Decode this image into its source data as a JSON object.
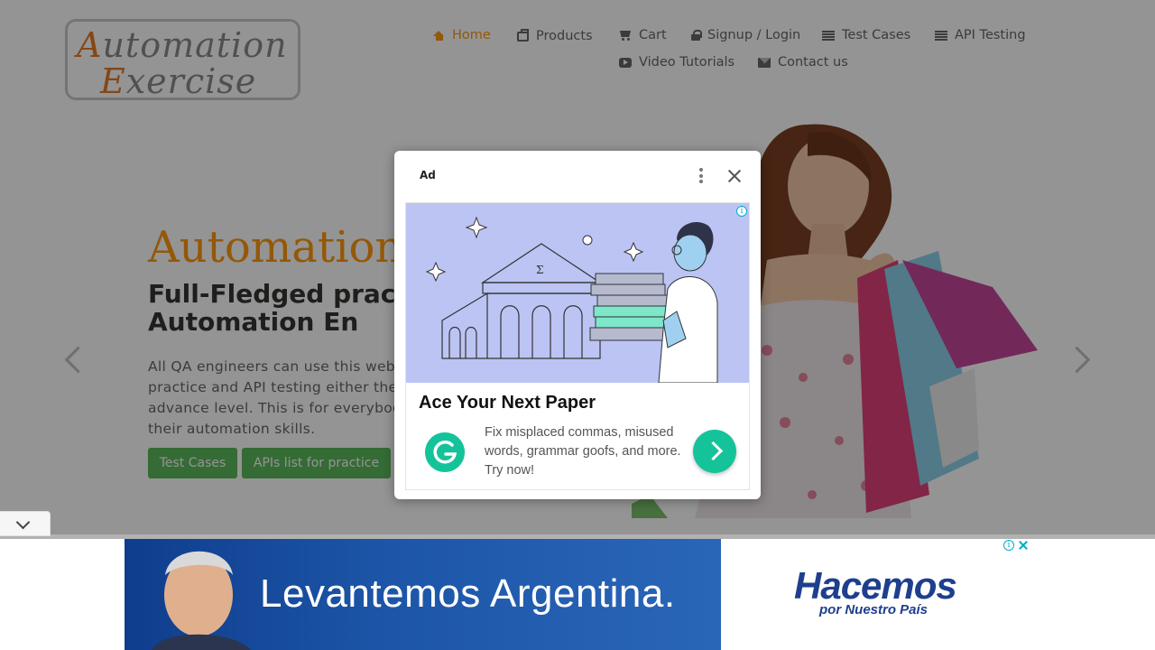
{
  "header": {
    "logo_line1_cap": "A",
    "logo_line1_rest": "utomation",
    "logo_line2_cap": "E",
    "logo_line2_rest": "xercise",
    "nav": {
      "home": "Home",
      "products": "Products",
      "cart": "Cart",
      "login": "Signup / Login",
      "test_cases": "Test Cases",
      "api_testing": "API Testing",
      "video_tutorials": "Video Tutorials",
      "contact_us": "Contact us"
    },
    "icons": [
      "home-icon",
      "briefcase-icon",
      "cart-icon",
      "lock-icon",
      "list-icon",
      "list-icon",
      "youtube-icon",
      "envelope-icon"
    ]
  },
  "hero": {
    "title": "Automation",
    "subtitle": "Full-Fledged prac for Automation En",
    "text": "All QA engineers can use this web practice and API testing either the advance level. This is for everybod their automation skills.",
    "btn_test_cases": "Test Cases",
    "btn_apis": "APIs list for practice"
  },
  "ad_modal": {
    "label": "Ad",
    "headline": "Ace Your Next Paper",
    "body": "Fix misplaced commas, misused words, grammar goofs, and more. Try now!",
    "info": "i"
  },
  "bottom_ad": {
    "tagline": "Levantemos Argentina.",
    "brand": "Hacemos",
    "brand_sub": "por Nuestro País",
    "info": "i"
  },
  "colors": {
    "accent": "#fe980f",
    "button_green": "#5cb85c",
    "grammarly_green": "#15c39a",
    "ad_art_bg": "#bcc4f4",
    "banner_blue": "#1e3f8e"
  }
}
